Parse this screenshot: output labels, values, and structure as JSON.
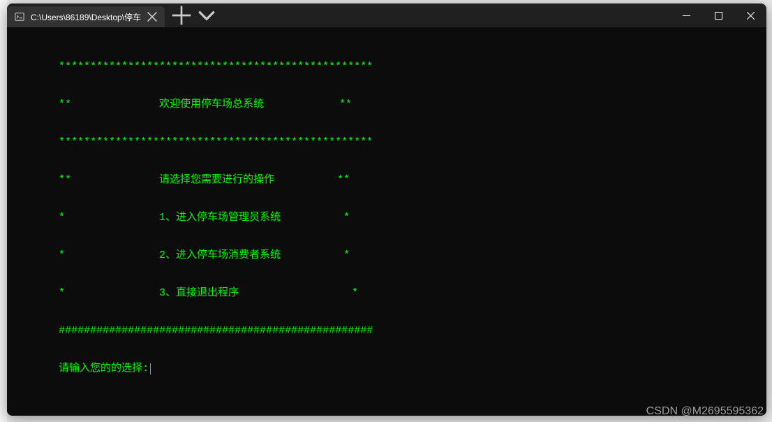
{
  "titlebar": {
    "tab_title": "C:\\Users\\86189\\Desktop\\停车",
    "new_tab_label": "+",
    "dropdown_label": "⌄"
  },
  "terminal": {
    "lines": [
      "**************************************************",
      "**              欢迎使用停车场总系统            **",
      "**************************************************",
      "**              请选择您需要进行的操作          **",
      "*               1、进入停车场管理员系统          *",
      "*               2、进入停车场消费者系统          *",
      "*               3、直接退出程序                  *",
      "##################################################"
    ],
    "prompt": "请输入您的的选择:"
  },
  "watermark": "CSDN @M2695595362",
  "bottom_hint": ""
}
